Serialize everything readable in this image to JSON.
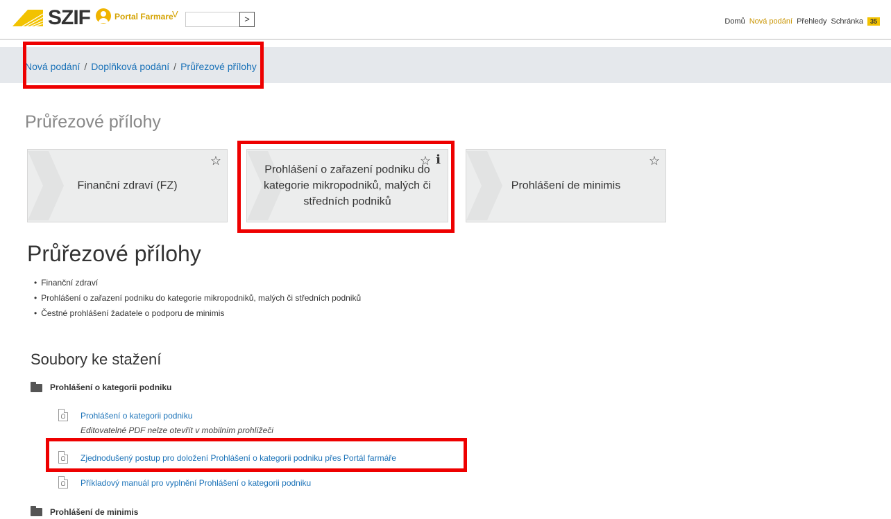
{
  "header": {
    "logo_text": "SZIF",
    "portal_label": "Portal Farmare",
    "chevron": "V",
    "go_arrow": ">",
    "nav": {
      "home": "Domů",
      "new_submissions": "Nová podání",
      "overviews": "Přehledy",
      "inbox": "Schránka",
      "inbox_count": "35"
    }
  },
  "breadcrumb": {
    "items": [
      "Nová podání",
      "Doplňková podání",
      "Průřezové přílohy"
    ],
    "separator": "/"
  },
  "page_title": "Průřezové přílohy",
  "tiles": [
    {
      "label": "Finanční zdraví (FZ)",
      "star": "☆"
    },
    {
      "label": "Prohlášení o zařazení podniku do kategorie mikropodniků, malých či středních podniků",
      "star": "☆",
      "info": "i"
    },
    {
      "label": "Prohlášení de minimis",
      "star": "☆"
    }
  ],
  "section_title": "Průřezové přílohy",
  "features": [
    "Finanční zdraví",
    "Prohlášení o zařazení podniku do kategorie mikropodniků, malých či středních podniků",
    "Čestné prohlášení žadatele o podporu de minimis"
  ],
  "downloads": {
    "title": "Soubory ke stažení",
    "groups": [
      {
        "label": "Prohlášení o kategorii podniku",
        "files": [
          {
            "label": "Prohlášení o kategorii podniku",
            "note": "Editovatelné PDF nelze otevřít v mobilním prohlížeči"
          },
          {
            "label": "Zjednodušený postup pro doložení Prohlášení o kategorii podniku přes Portál farmáře"
          },
          {
            "label": "Příkladový manuál pro vyplnění Prohlášení o kategorii podniku"
          }
        ]
      },
      {
        "label": "Prohlášení de minimis"
      }
    ]
  },
  "colors": {
    "brand_yellow": "#f0b400",
    "link_blue": "#1a72b8",
    "highlight_red": "#ee0000",
    "tile_bg": "#eceded"
  }
}
